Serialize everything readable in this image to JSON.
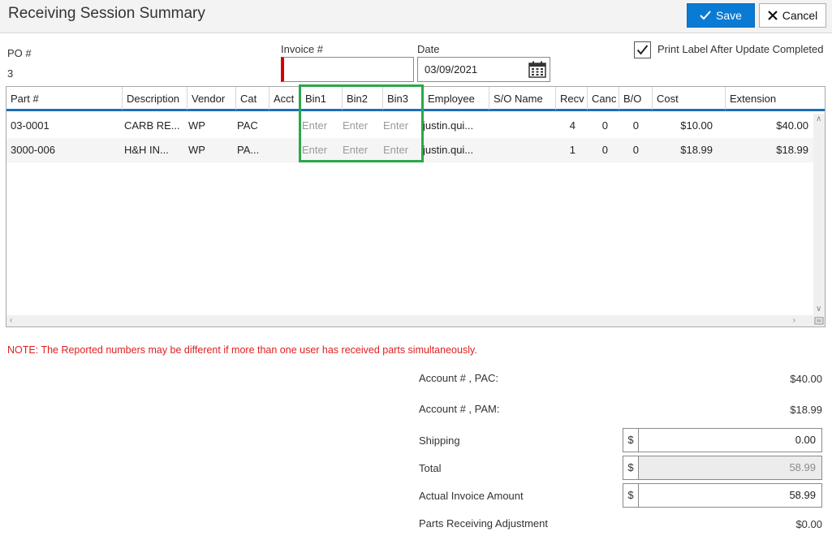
{
  "window": {
    "title": "Receiving Session Summary"
  },
  "toolbar": {
    "save_label": "Save",
    "cancel_label": "Cancel"
  },
  "po": {
    "label": "PO #",
    "value": "3"
  },
  "invoice": {
    "label": "Invoice #",
    "value": ""
  },
  "date": {
    "label": "Date",
    "value": "03/09/2021"
  },
  "print_label": {
    "label": "Print Label After Update Completed",
    "checked": true
  },
  "grid": {
    "columns": [
      "Part #",
      "Description",
      "Vendor",
      "Cat",
      "Acct",
      "Bin1",
      "Bin2",
      "Bin3",
      "Employee",
      "S/O Name",
      "Recv",
      "Canc",
      "B/O",
      "Cost",
      "Extension"
    ],
    "rows": [
      {
        "part": "03-0001",
        "description": "CARB RE...",
        "vendor": "WP",
        "cat": "PAC",
        "acct": "",
        "bin1": "Enter",
        "bin2": "Enter",
        "bin3": "Enter",
        "employee": "justin.qui...",
        "so_name": "",
        "recv": "4",
        "canc": "0",
        "bo": "0",
        "cost": "$10.00",
        "extension": "$40.00"
      },
      {
        "part": "3000-006",
        "description": "H&H IN...",
        "vendor": "WP",
        "cat": "PA...",
        "acct": "",
        "bin1": "Enter",
        "bin2": "Enter",
        "bin3": "Enter",
        "employee": "justin.qui...",
        "so_name": "",
        "recv": "1",
        "canc": "0",
        "bo": "0",
        "cost": "$18.99",
        "extension": "$18.99"
      }
    ]
  },
  "note": "NOTE: The Reported numbers may be different if more than one user has received parts simultaneously.",
  "summary": {
    "account_pac_label": "Account # , PAC:",
    "account_pac_value": "$40.00",
    "account_pam_label": "Account # , PAM:",
    "account_pam_value": "$18.99",
    "currency_symbol": "$",
    "shipping_label": "Shipping",
    "shipping_value": "0.00",
    "total_label": "Total",
    "total_value": "58.99",
    "actual_invoice_label": "Actual Invoice Amount",
    "actual_invoice_value": "58.99",
    "adjustment_label": "Parts Receiving Adjustment",
    "adjustment_value": "$0.00"
  },
  "colors": {
    "accent": "#0a7bd4",
    "required": "#d40000",
    "note": "#e02020",
    "highlight": "#2aa74a",
    "header_rule": "#1e6fb5"
  }
}
